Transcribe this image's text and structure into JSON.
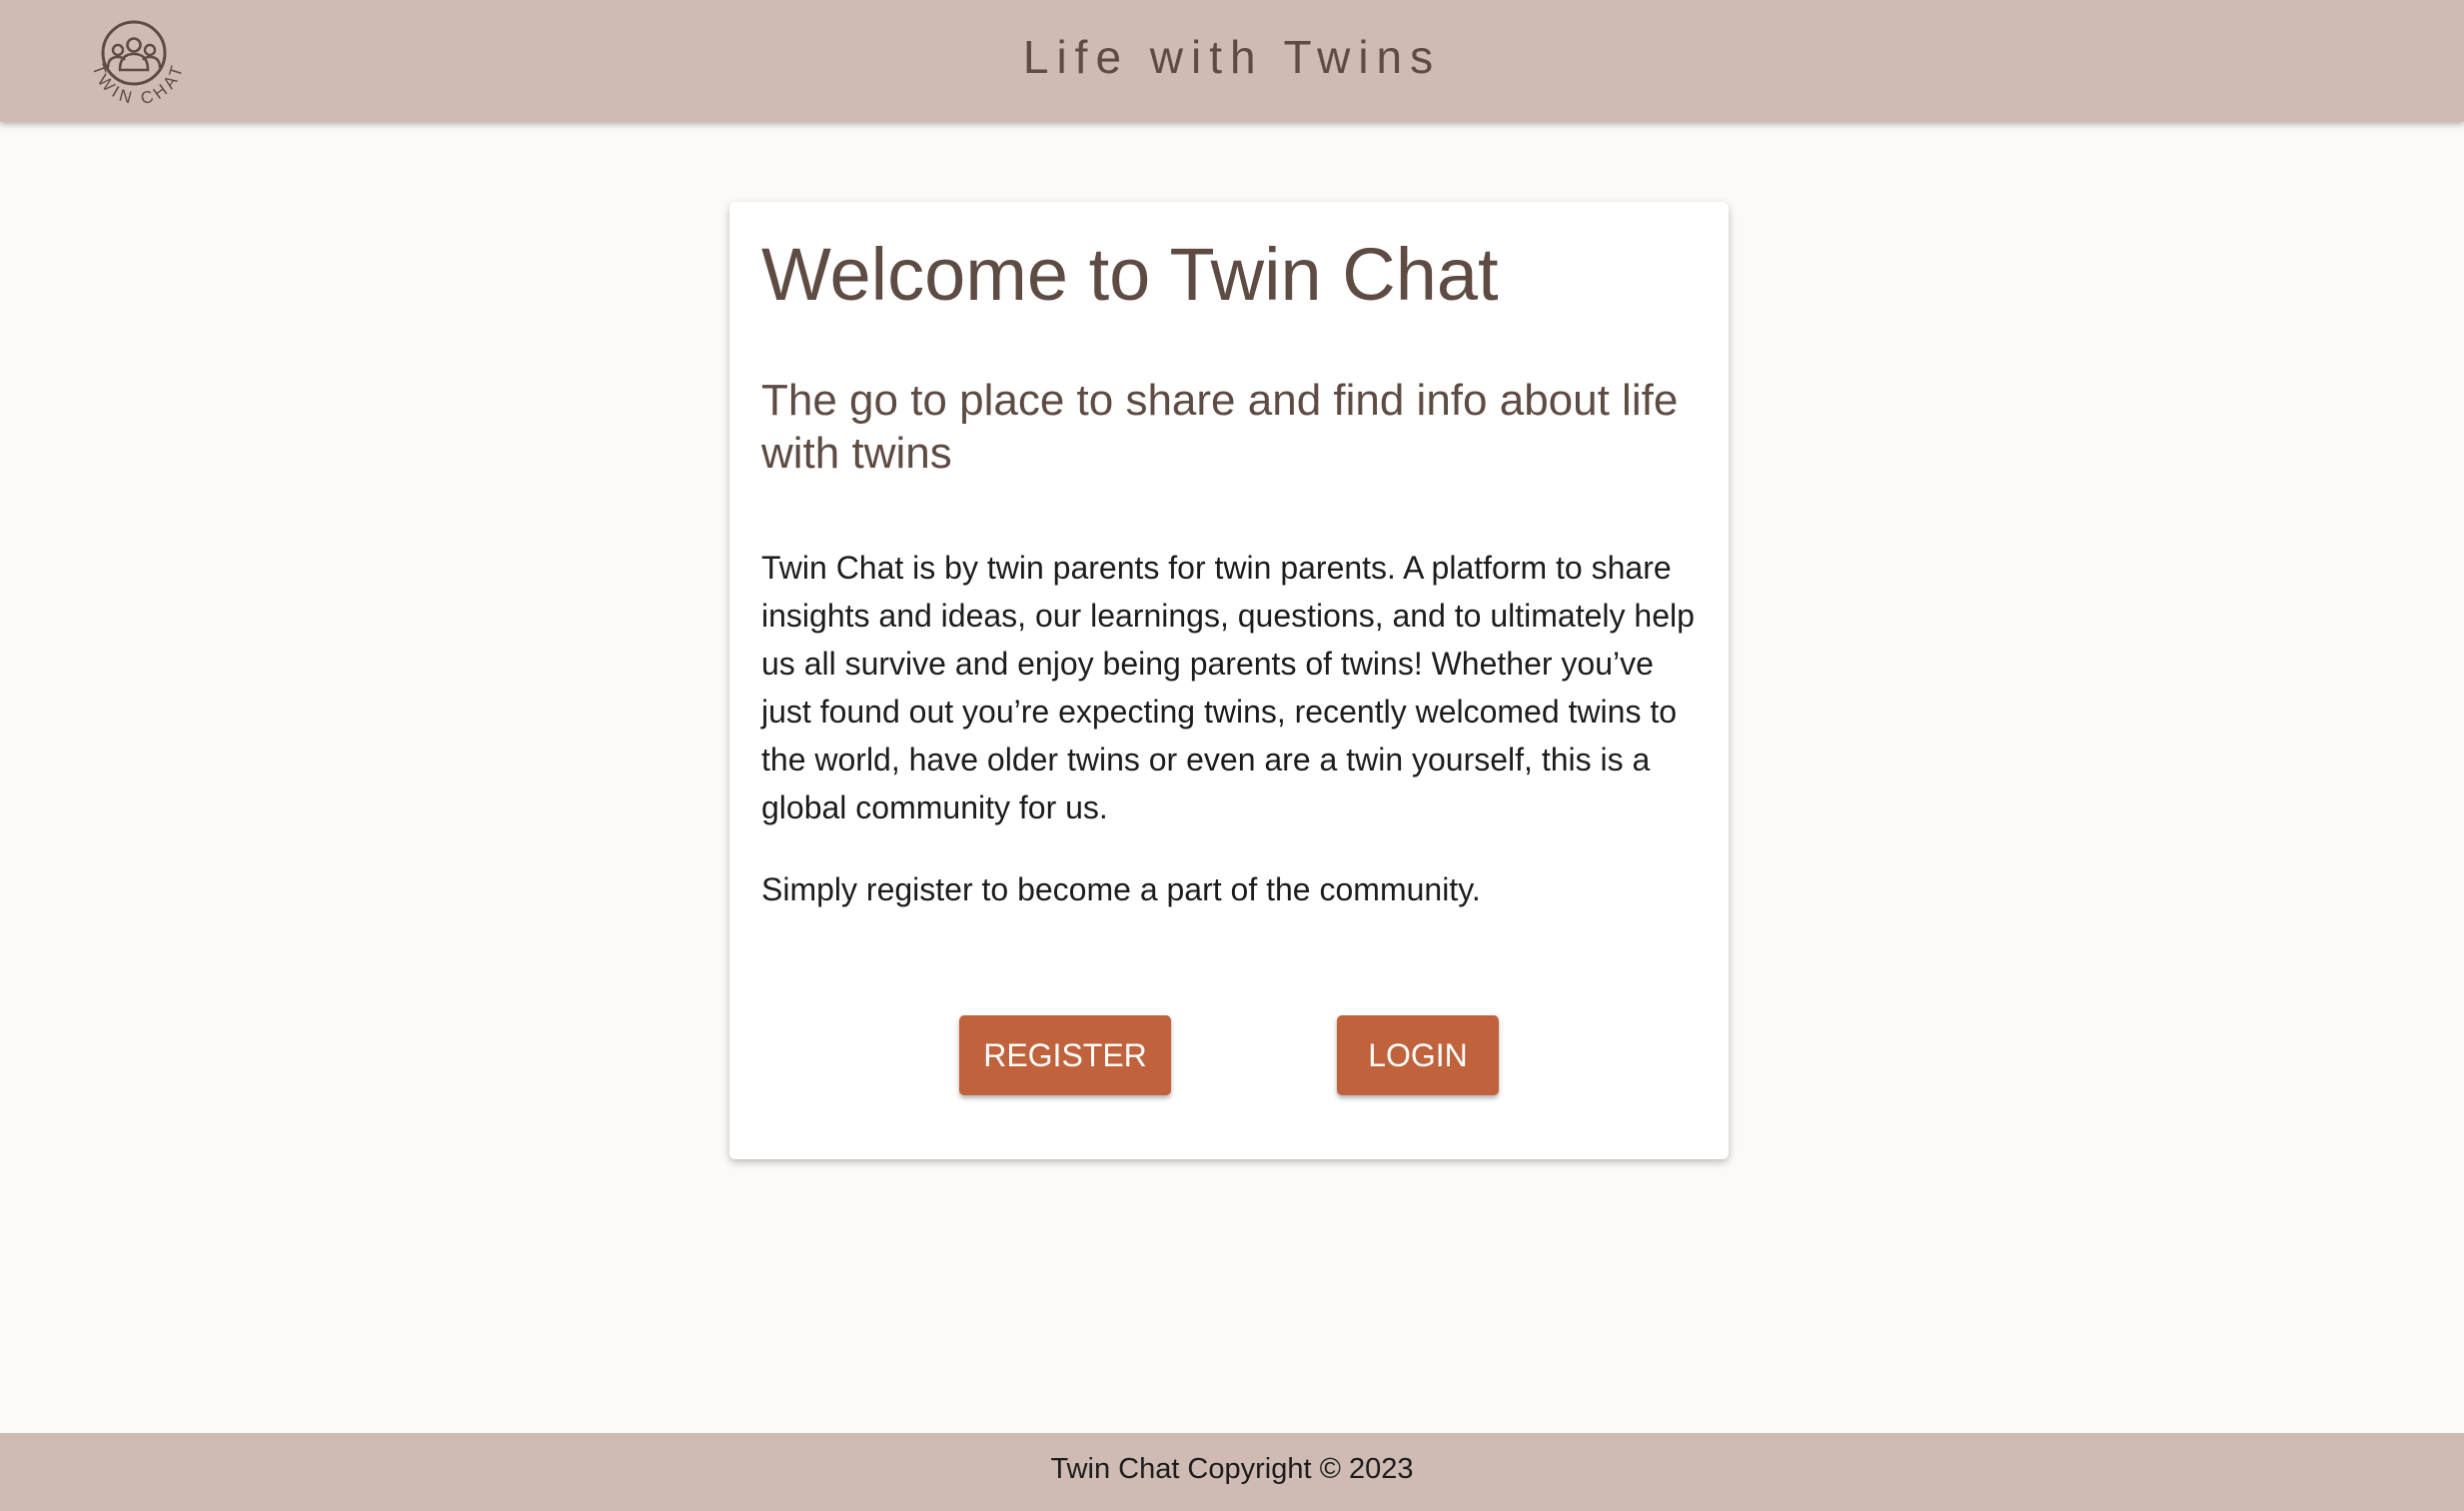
{
  "header": {
    "logo_text": "TWIN CHAT",
    "site_title": "Life with Twins"
  },
  "card": {
    "title": "Welcome to Twin Chat",
    "subtitle": "The go to place to share and find info about life with twins",
    "body": "Twin Chat is by twin parents for twin parents. A platform to share insights and ideas, our learnings, questions, and to ultimately help us all survive and enjoy being parents of twins! Whether you’ve just found out you’re expecting twins, recently welcomed twins to the world, have older twins or even are a twin yourself, this is a global community for us.",
    "cta_text": "Simply register to become a part of the community.",
    "register_label": "REGISTER",
    "login_label": "LOGIN"
  },
  "footer": {
    "copyright": "Twin Chat Copyright © 2023"
  },
  "colors": {
    "header_bg": "#cfbbb3",
    "page_bg": "#fcf9f7",
    "accent_button": "#c0623b",
    "heading_text": "#5e4b43"
  },
  "icons": {
    "logo": "family-circle-icon"
  }
}
